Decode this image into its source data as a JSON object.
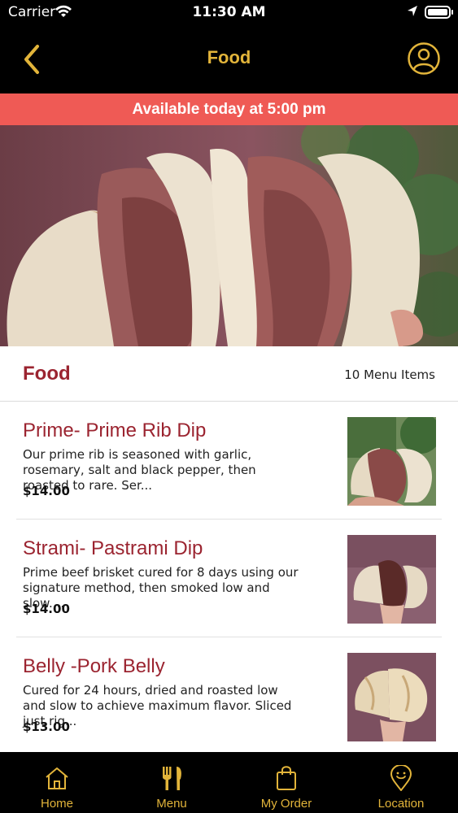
{
  "status_bar": {
    "carrier": "Carrier",
    "time": "11:30 AM"
  },
  "nav": {
    "title": "Food",
    "back_icon": "chevron-left-icon",
    "profile_icon": "user-circle-icon",
    "accent_color": "#e2b43a"
  },
  "banner": {
    "text": "Available today at 5:00 pm",
    "color": "#ef5a55"
  },
  "section": {
    "title": "Food",
    "count": "10 Menu Items"
  },
  "items": [
    {
      "name": "Prime- Prime Rib Dip",
      "description": "Our prime rib is seasoned with garlic, rosemary, salt and black pepper, then roasted to rare. Ser...",
      "price": "$14.00"
    },
    {
      "name": "Strami- Pastrami Dip",
      "description": "Prime beef brisket cured for 8 days using our signature method, then smoked low and slow....",
      "price": "$14.00"
    },
    {
      "name": "Belly -Pork Belly",
      "description": "Cured for 24 hours, dried and roasted low and slow to achieve maximum flavor. Sliced just rig...",
      "price": "$13.00"
    }
  ],
  "tabs": [
    {
      "label": "Home",
      "icon": "home-icon"
    },
    {
      "label": "Menu",
      "icon": "fork-knife-icon",
      "active": true
    },
    {
      "label": "My Order",
      "icon": "shopping-bag-icon"
    },
    {
      "label": "Location",
      "icon": "location-pin-icon"
    }
  ]
}
